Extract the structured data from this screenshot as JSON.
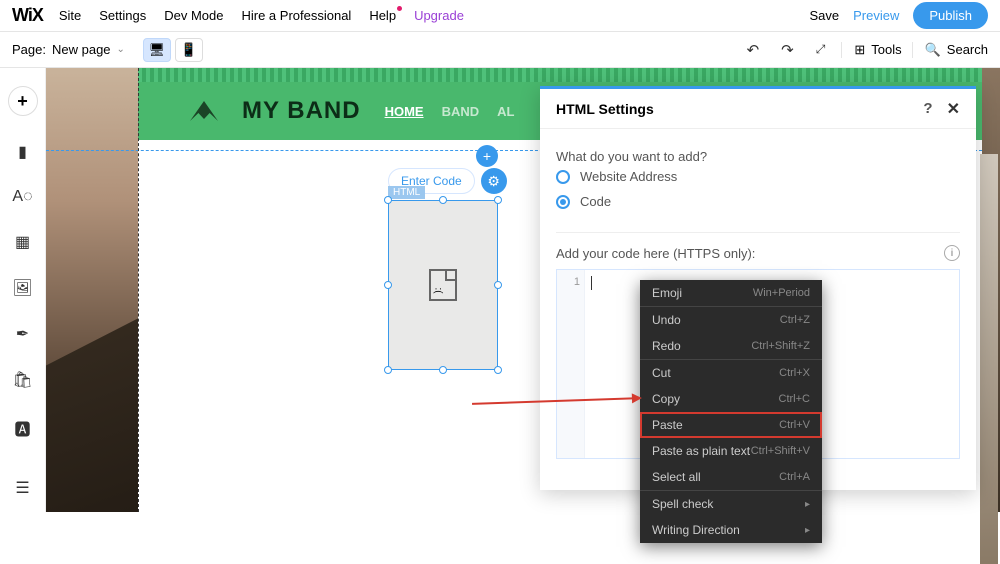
{
  "topmenu": {
    "logo": "WiX",
    "site": "Site",
    "settings": "Settings",
    "devmode": "Dev Mode",
    "hire": "Hire a Professional",
    "help": "Help",
    "upgrade": "Upgrade",
    "save": "Save",
    "preview": "Preview",
    "publish": "Publish"
  },
  "secbar": {
    "page_label": "Page:",
    "page_name": "New page",
    "tools": "Tools",
    "search": "Search"
  },
  "site_header": {
    "title": "MY BAND",
    "nav_home": "HOME",
    "nav_band": "BAND",
    "nav_al": "AL"
  },
  "elementbar": {
    "enter_code": "Enter Code",
    "tag": "HTML"
  },
  "panel": {
    "title": "HTML Settings",
    "q_add": "What do you want to add?",
    "opt_website": "Website Address",
    "opt_code": "Code",
    "code_label": "Add your code here (HTTPS only):",
    "line1": "1"
  },
  "ctx": {
    "emoji": "Emoji",
    "emoji_sc": "Win+Period",
    "undo": "Undo",
    "undo_sc": "Ctrl+Z",
    "redo": "Redo",
    "redo_sc": "Ctrl+Shift+Z",
    "cut": "Cut",
    "cut_sc": "Ctrl+X",
    "copy": "Copy",
    "copy_sc": "Ctrl+C",
    "paste": "Paste",
    "paste_sc": "Ctrl+V",
    "paste_plain": "Paste as plain text",
    "paste_plain_sc": "Ctrl+Shift+V",
    "select_all": "Select all",
    "select_all_sc": "Ctrl+A",
    "spell": "Spell check",
    "writing": "Writing Direction"
  }
}
